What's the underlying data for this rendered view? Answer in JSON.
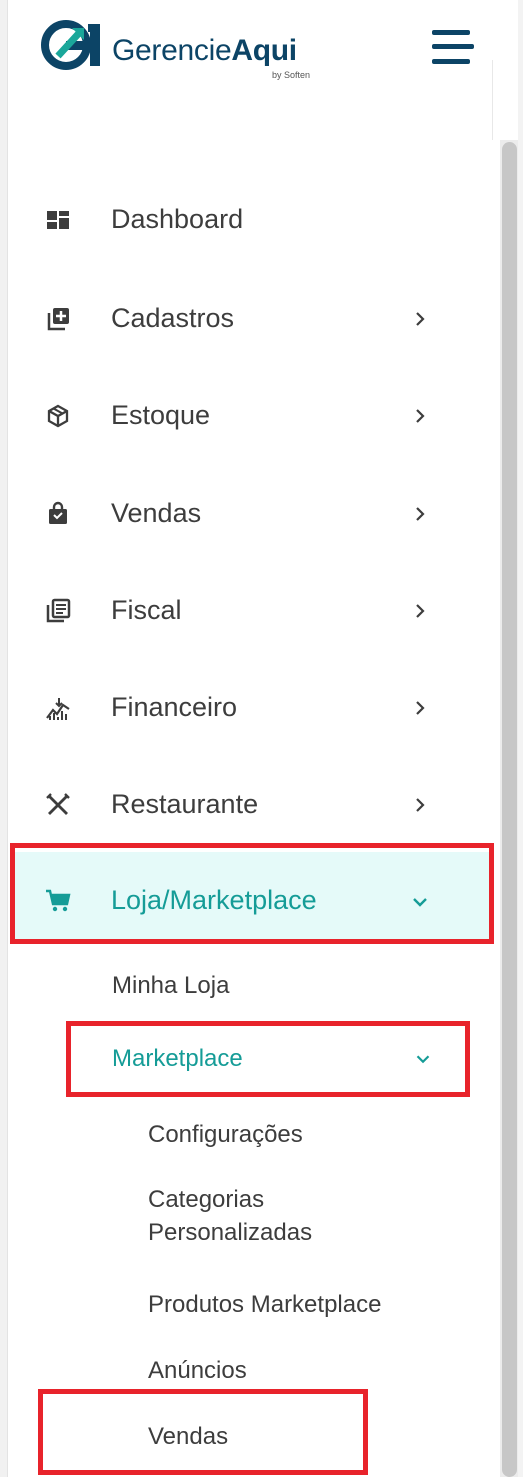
{
  "brand": {
    "name_light": "Gerencie",
    "name_bold": "Aqui",
    "byline": "by Soften",
    "color": "#0c4466"
  },
  "accent_color": "#159c97",
  "highlight_color": "#e8232b",
  "menu": {
    "items": [
      {
        "label": "Dashboard",
        "icon": "dashboard-icon"
      },
      {
        "label": "Cadastros",
        "icon": "add-box-icon",
        "chevron": "chevron-right-icon"
      },
      {
        "label": "Estoque",
        "icon": "package-icon",
        "chevron": "chevron-right-icon"
      },
      {
        "label": "Vendas",
        "icon": "shopping-bag-icon",
        "chevron": "chevron-right-icon"
      },
      {
        "label": "Fiscal",
        "icon": "document-list-icon",
        "chevron": "chevron-right-icon"
      },
      {
        "label": "Financeiro",
        "icon": "trend-chart-icon",
        "chevron": "chevron-right-icon"
      },
      {
        "label": "Restaurante",
        "icon": "utensils-icon",
        "chevron": "chevron-right-icon"
      },
      {
        "label": "Loja/Marketplace",
        "icon": "shopping-cart-icon",
        "chevron": "chevron-down-icon",
        "expanded": true
      }
    ],
    "loja_submenu": {
      "minha_loja": "Minha Loja",
      "marketplace": "Marketplace",
      "marketplace_children": {
        "configuracoes": "Configurações",
        "categorias_line1": "Categorias",
        "categorias_line2": "Personalizadas",
        "produtos": "Produtos Marketplace",
        "anuncios": "Anúncios",
        "vendas": "Vendas"
      }
    }
  }
}
